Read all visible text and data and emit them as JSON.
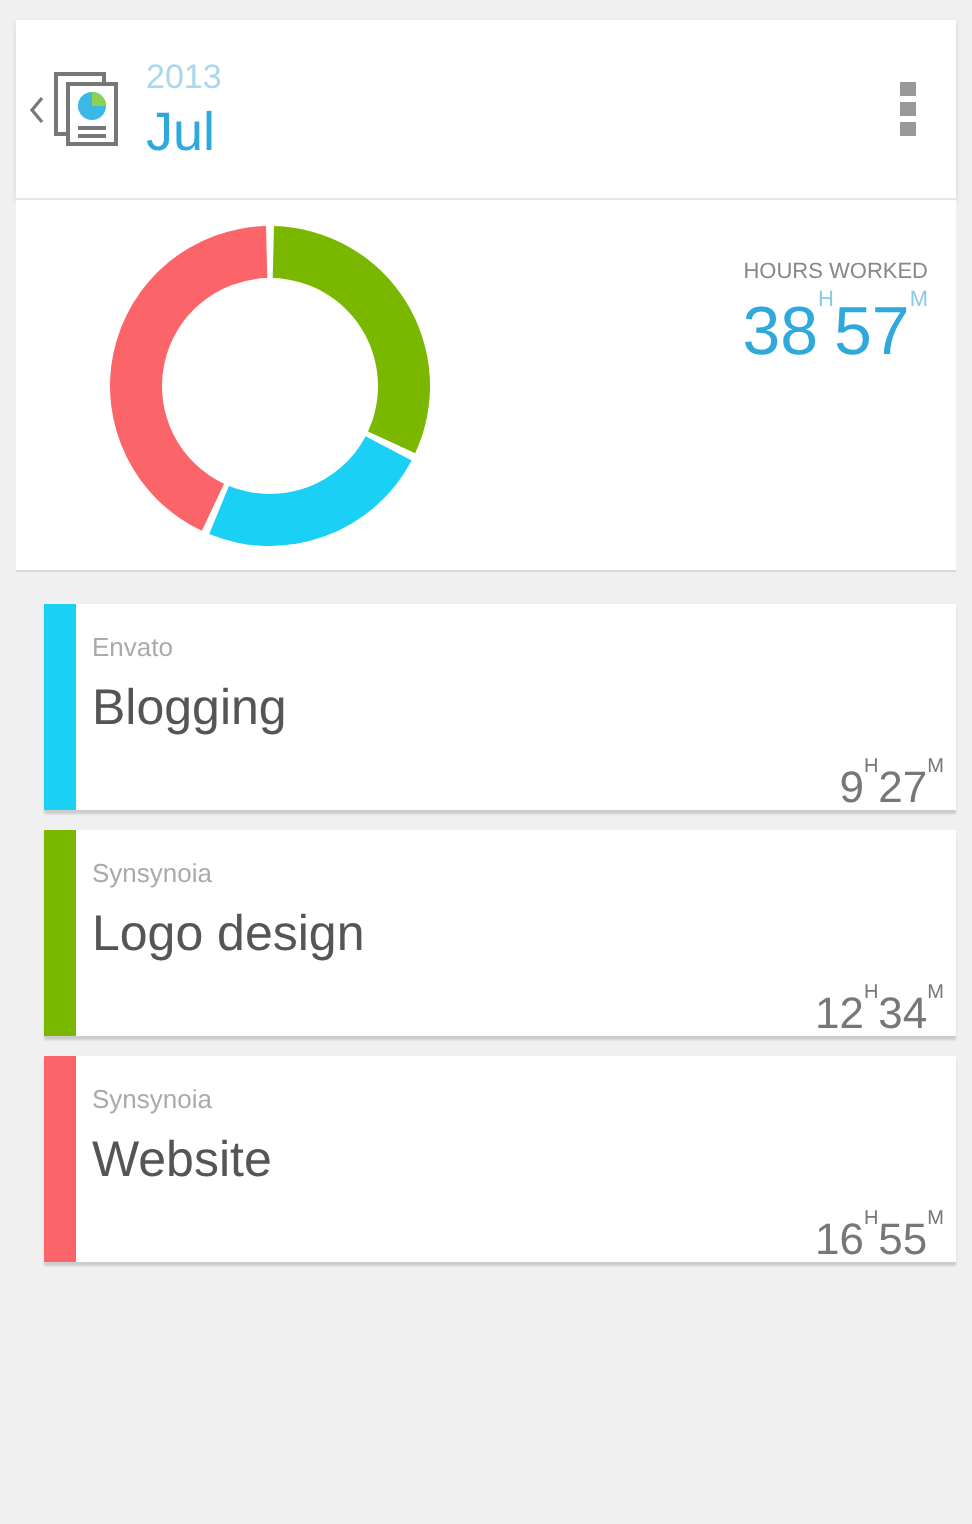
{
  "header": {
    "year": "2013",
    "month": "Jul"
  },
  "summary": {
    "label": "HOURS WORKED",
    "total": "38$^{H}$57$^{M}$",
    "chart_data": {
      "type": "donut",
      "series": [
        {
          "values": [
            32.3,
            24.3,
            43.4
          ]
        }
      ]
    }
  },
  "projects": [
    {
      "client": "Envato",
      "name": "Blogging",
      "time": "9$^{H}$27$^{M}$",
      "color": "#1ad0f5"
    },
    {
      "client": "Synsynoia",
      "name": "Logo design",
      "time": "12$^{H}$34$^{M}$",
      "color": "#7ab800"
    },
    {
      "client": "Synsynoia",
      "name": "Website",
      "time": "16$^{H}$55$^{M}$",
      "color": "#fb6468"
    }
  ]
}
